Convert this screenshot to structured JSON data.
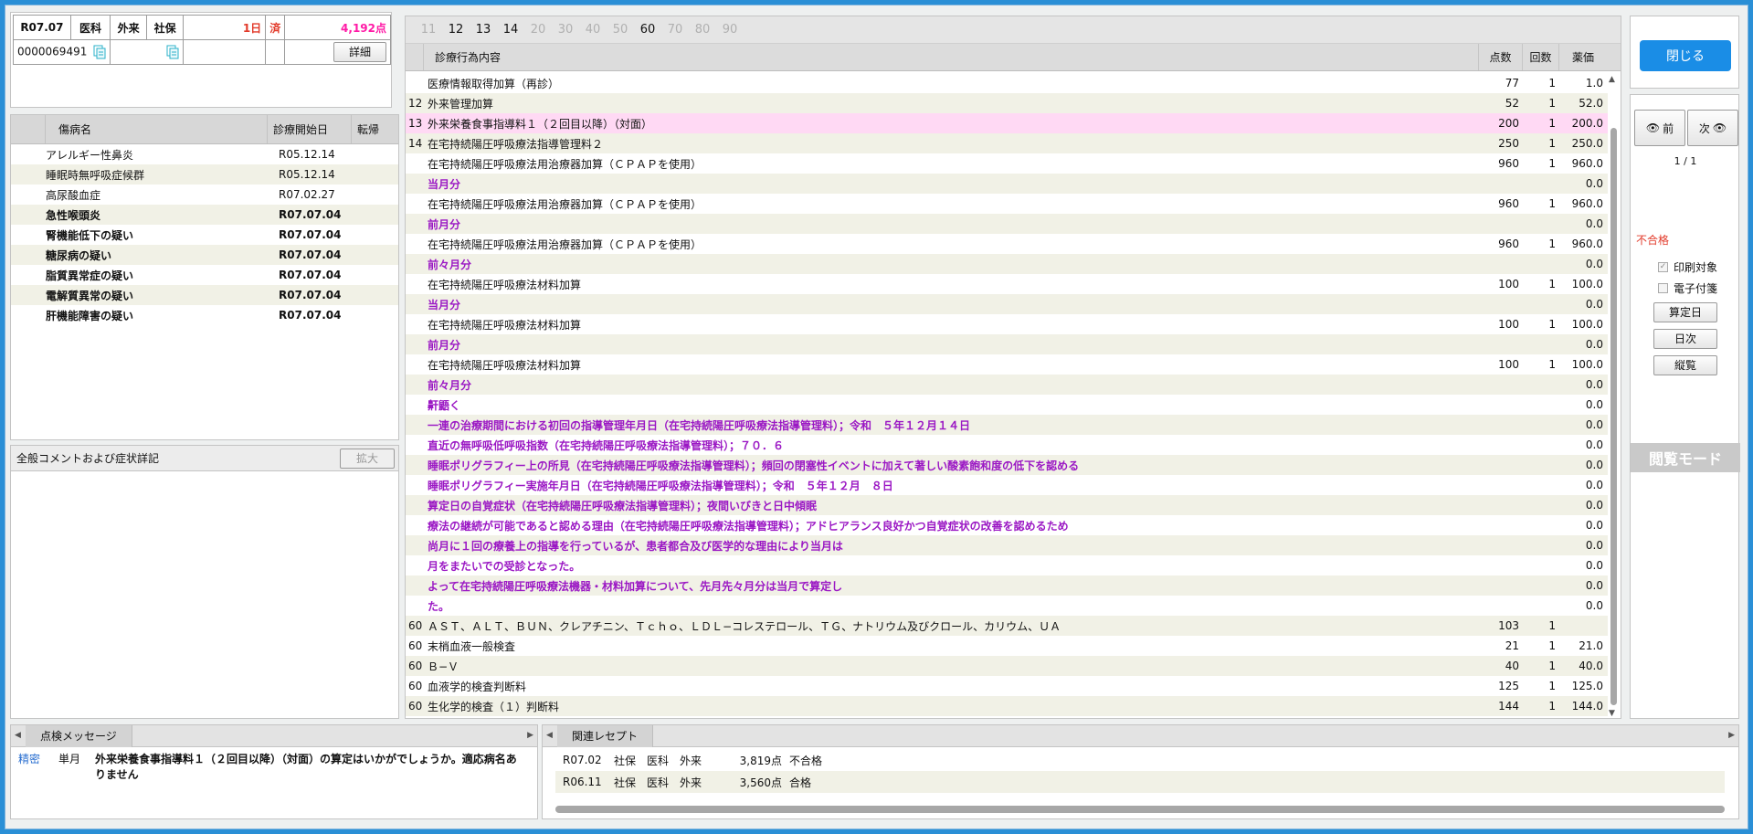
{
  "header": {
    "era_month": "R07.07",
    "dept": "医科",
    "visit_type": "外来",
    "insurance": "社保",
    "days": "1日",
    "status": "済",
    "points": "4,192点",
    "patient_id": "0000069491",
    "detail_button": "詳細"
  },
  "disease_list": {
    "columns": [
      "傷病名",
      "診療開始日",
      "転帰"
    ],
    "rows": [
      {
        "name": "アレルギー性鼻炎",
        "date": "R05.12.14",
        "bold": false
      },
      {
        "name": "睡眠時無呼吸症候群",
        "date": "R05.12.14",
        "bold": false
      },
      {
        "name": "高尿酸血症",
        "date": "R07.02.27",
        "bold": false
      },
      {
        "name": "急性喉頭炎",
        "date": "R07.07.04",
        "bold": true
      },
      {
        "name": "腎機能低下の疑い",
        "date": "R07.07.04",
        "bold": true
      },
      {
        "name": "糖尿病の疑い",
        "date": "R07.07.04",
        "bold": true
      },
      {
        "name": "脂質異常症の疑い",
        "date": "R07.07.04",
        "bold": true
      },
      {
        "name": "電解質異常の疑い",
        "date": "R07.07.04",
        "bold": true
      },
      {
        "name": "肝機能障害の疑い",
        "date": "R07.07.04",
        "bold": true
      }
    ]
  },
  "comment_panel": {
    "title": "全般コメントおよび症状詳記",
    "expand_button": "拡大"
  },
  "main_tabs": [
    {
      "label": "11",
      "active": false
    },
    {
      "label": "12",
      "active": true
    },
    {
      "label": "13",
      "active": true
    },
    {
      "label": "14",
      "active": true
    },
    {
      "label": "20",
      "active": false
    },
    {
      "label": "30",
      "active": false
    },
    {
      "label": "40",
      "active": false
    },
    {
      "label": "50",
      "active": false
    },
    {
      "label": "60",
      "active": true
    },
    {
      "label": "70",
      "active": false
    },
    {
      "label": "80",
      "active": false
    },
    {
      "label": "90",
      "active": false
    }
  ],
  "main_columns": {
    "name": "診療行為内容",
    "points": "点数",
    "count": "回数",
    "value": "薬価"
  },
  "main_rows": [
    {
      "code": "",
      "name": "医療情報取得加算（再診）",
      "points": "77",
      "count": "1",
      "value": "1.0",
      "comment": false,
      "hl": false
    },
    {
      "code": "12",
      "name": "外来管理加算",
      "points": "52",
      "count": "1",
      "value": "52.0",
      "comment": false,
      "hl": false
    },
    {
      "code": "13",
      "name": "外来栄養食事指導料１（２回目以降）（対面）",
      "points": "200",
      "count": "1",
      "value": "200.0",
      "comment": false,
      "hl": true
    },
    {
      "code": "14",
      "name": "在宅持続陽圧呼吸療法指導管理料２",
      "points": "250",
      "count": "1",
      "value": "250.0",
      "comment": false,
      "hl": false
    },
    {
      "code": "",
      "name": "在宅持続陽圧呼吸療法用治療器加算（ＣＰＡＰを使用）",
      "points": "960",
      "count": "1",
      "value": "960.0",
      "comment": false,
      "hl": false
    },
    {
      "code": "",
      "name": "当月分",
      "points": "",
      "count": "",
      "value": "0.0",
      "comment": true,
      "hl": false
    },
    {
      "code": "",
      "name": "在宅持続陽圧呼吸療法用治療器加算（ＣＰＡＰを使用）",
      "points": "960",
      "count": "1",
      "value": "960.0",
      "comment": false,
      "hl": false
    },
    {
      "code": "",
      "name": "前月分",
      "points": "",
      "count": "",
      "value": "0.0",
      "comment": true,
      "hl": false
    },
    {
      "code": "",
      "name": "在宅持続陽圧呼吸療法用治療器加算（ＣＰＡＰを使用）",
      "points": "960",
      "count": "1",
      "value": "960.0",
      "comment": false,
      "hl": false
    },
    {
      "code": "",
      "name": "前々月分",
      "points": "",
      "count": "",
      "value": "0.0",
      "comment": true,
      "hl": false
    },
    {
      "code": "",
      "name": "在宅持続陽圧呼吸療法材料加算",
      "points": "100",
      "count": "1",
      "value": "100.0",
      "comment": false,
      "hl": false
    },
    {
      "code": "",
      "name": "当月分",
      "points": "",
      "count": "",
      "value": "0.0",
      "comment": true,
      "hl": false
    },
    {
      "code": "",
      "name": "在宅持続陽圧呼吸療法材料加算",
      "points": "100",
      "count": "1",
      "value": "100.0",
      "comment": false,
      "hl": false
    },
    {
      "code": "",
      "name": "前月分",
      "points": "",
      "count": "",
      "value": "0.0",
      "comment": true,
      "hl": false
    },
    {
      "code": "",
      "name": "在宅持続陽圧呼吸療法材料加算",
      "points": "100",
      "count": "1",
      "value": "100.0",
      "comment": false,
      "hl": false
    },
    {
      "code": "",
      "name": "前々月分",
      "points": "",
      "count": "",
      "value": "0.0",
      "comment": true,
      "hl": false
    },
    {
      "code": "",
      "name": "鼾鼯く",
      "points": "",
      "count": "",
      "value": "0.0",
      "comment": true,
      "hl": false
    },
    {
      "code": "",
      "name": "一連の治療期間における初回の指導管理年月日（在宅持続陽圧呼吸療法指導管理料）；令和　５年１２月１４日",
      "points": "",
      "count": "",
      "value": "0.0",
      "comment": true,
      "hl": false
    },
    {
      "code": "",
      "name": "直近の無呼吸低呼吸指数（在宅持続陽圧呼吸療法指導管理料）；７０．６",
      "points": "",
      "count": "",
      "value": "0.0",
      "comment": true,
      "hl": false
    },
    {
      "code": "",
      "name": "睡眠ポリグラフィー上の所見（在宅持続陽圧呼吸療法指導管理料）；頻回の閉塞性イベントに加えて著しい酸素飽和度の低下を認める",
      "points": "",
      "count": "",
      "value": "0.0",
      "comment": true,
      "hl": false
    },
    {
      "code": "",
      "name": "睡眠ポリグラフィー実施年月日（在宅持続陽圧呼吸療法指導管理料）；令和　５年１２月　８日",
      "points": "",
      "count": "",
      "value": "0.0",
      "comment": true,
      "hl": false
    },
    {
      "code": "",
      "name": "算定日の自覚症状（在宅持続陽圧呼吸療法指導管理料）；夜間いびきと日中傾眠",
      "points": "",
      "count": "",
      "value": "0.0",
      "comment": true,
      "hl": false
    },
    {
      "code": "",
      "name": "療法の継続が可能であると認める理由（在宅持続陽圧呼吸療法指導管理料）；アドヒアランス良好かつ自覚症状の改善を認めるため",
      "points": "",
      "count": "",
      "value": "0.0",
      "comment": true,
      "hl": false
    },
    {
      "code": "",
      "name": "尚月に１回の療養上の指導を行っているが、患者都合及び医学的な理由により当月は",
      "points": "",
      "count": "",
      "value": "0.0",
      "comment": true,
      "hl": false
    },
    {
      "code": "",
      "name": "月をまたいでの受診となった。",
      "points": "",
      "count": "",
      "value": "0.0",
      "comment": true,
      "hl": false
    },
    {
      "code": "",
      "name": "よって在宅持続陽圧呼吸療法機器・材料加算について、先月先々月分は当月で算定し",
      "points": "",
      "count": "",
      "value": "0.0",
      "comment": true,
      "hl": false
    },
    {
      "code": "",
      "name": "た。",
      "points": "",
      "count": "",
      "value": "0.0",
      "comment": true,
      "hl": false
    },
    {
      "code": "60",
      "name": "ＡＳＴ、ＡＬＴ、ＢＵＮ、クレアチニン、Ｔｃｈｏ、ＬＤＬ−コレステロール、ＴＧ、ナトリウム及びクロール、カリウム、ＵＡ",
      "points": "103",
      "count": "1",
      "value": "",
      "comment": false,
      "hl": false
    },
    {
      "code": "60",
      "name": "末梢血液一般検査",
      "points": "21",
      "count": "1",
      "value": "21.0",
      "comment": false,
      "hl": false
    },
    {
      "code": "60",
      "name": "Ｂ−Ｖ",
      "points": "40",
      "count": "1",
      "value": "40.0",
      "comment": false,
      "hl": false
    },
    {
      "code": "60",
      "name": "血液学的検査判断料",
      "points": "125",
      "count": "1",
      "value": "125.0",
      "comment": false,
      "hl": false
    },
    {
      "code": "60",
      "name": "生化学的検査（１）判断料",
      "points": "144",
      "count": "1",
      "value": "144.0",
      "comment": false,
      "hl": false
    }
  ],
  "right_panel": {
    "close_button": "閉じる",
    "prev_button": "前",
    "next_button": "次",
    "pager": "1 / 1",
    "result": "不合格",
    "print_target": "印刷対象",
    "e_attach": "電子付箋",
    "calc_day_button": "算定日",
    "daily_button": "日次",
    "vertical_button": "縦覧",
    "mode_label": "閲覧モード"
  },
  "inspection": {
    "tab": "点検メッセージ",
    "type": "精密",
    "scope": "単月",
    "message": "外来栄養食事指導料１（２回目以降）（対面）の算定はいかがでしょうか。適応病名ありません"
  },
  "related": {
    "tab": "関連レセプト",
    "rows": [
      {
        "month": "R07.02",
        "ins": "社保",
        "dept": "医科",
        "visit": "外来",
        "points": "3,819点",
        "result": "不合格"
      },
      {
        "month": "R06.11",
        "ins": "社保",
        "dept": "医科",
        "visit": "外来",
        "points": "3,560点",
        "result": "合格"
      }
    ]
  }
}
